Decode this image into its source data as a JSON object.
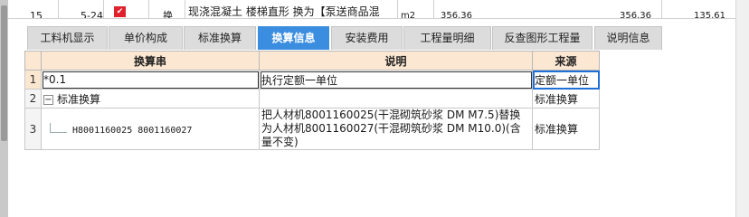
{
  "top_row": {
    "row_number": "15",
    "code": "5-24",
    "flag_icon": "red-flag-icon",
    "type": "换",
    "name": "现浇混凝土  楼梯直形   换为【泵送商品混",
    "unit": "m2",
    "value1": "356.36",
    "value2": "356.36",
    "value3": "135.61"
  },
  "tabs": [
    {
      "label": "工料机显示",
      "active": false
    },
    {
      "label": "单价构成",
      "active": false
    },
    {
      "label": "标准换算",
      "active": false
    },
    {
      "label": "换算信息",
      "active": true
    },
    {
      "label": "安装费用",
      "active": false
    },
    {
      "label": "工程量明细",
      "active": false
    },
    {
      "label": "反查图形工程量",
      "active": false
    },
    {
      "label": "说明信息",
      "active": false
    }
  ],
  "grid": {
    "headers": {
      "formula": "换算串",
      "description": "说明",
      "source": "来源"
    },
    "rows": [
      {
        "num": "1",
        "formula": "*0.1",
        "description": "执行定额一单位",
        "source": "定额一单位"
      },
      {
        "num": "2",
        "expander": "−",
        "formula": "标准换算",
        "description": "",
        "source": "标准换算"
      },
      {
        "num": "3",
        "formula": "H8001160025 8001160027",
        "description": "把人材机8001160025(干混砌筑砂浆 DM M7.5)替换为人材机8001160027(干混砌筑砂浆 DM M10.0)(含量不变)",
        "source": "标准换算"
      }
    ]
  },
  "colors": {
    "active_tab": "#3b8de0",
    "header_bg": "#fce7d2",
    "selection_border": "#1f6fd6"
  }
}
